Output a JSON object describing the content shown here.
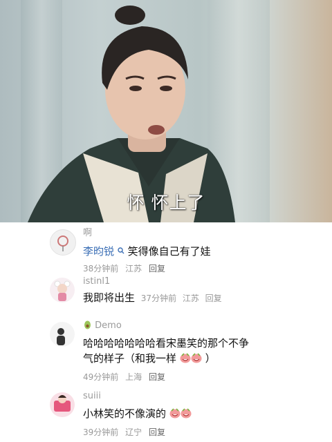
{
  "video": {
    "subtitle": "怀 怀上了"
  },
  "comments": [
    {
      "parent_user": "啊",
      "user": "李昀锐",
      "text": "笑得像自己有了娃",
      "time": "38分钟前",
      "location": "江苏",
      "reply_label": "回复"
    },
    {
      "user": "istinl1",
      "text": "我即将出生",
      "time": "37分钟前",
      "location": "江苏",
      "reply_label": "回复"
    },
    {
      "user": "Demo",
      "text_line1": "哈哈哈哈哈哈哈看宋墨笑的那个不争",
      "text_line2": "气的样子（和我一样",
      "text_line2_end": "）",
      "time": "49分钟前",
      "location": "上海",
      "reply_label": "回复"
    },
    {
      "user": "suiii",
      "text": "小林笑的不像演的",
      "time": "39分钟前",
      "location": "辽宁",
      "reply_label": "回复"
    }
  ],
  "icons": {
    "search": "search-icon",
    "emoji": "laughing-emoji-icon",
    "badge": "avocado-badge-icon"
  }
}
